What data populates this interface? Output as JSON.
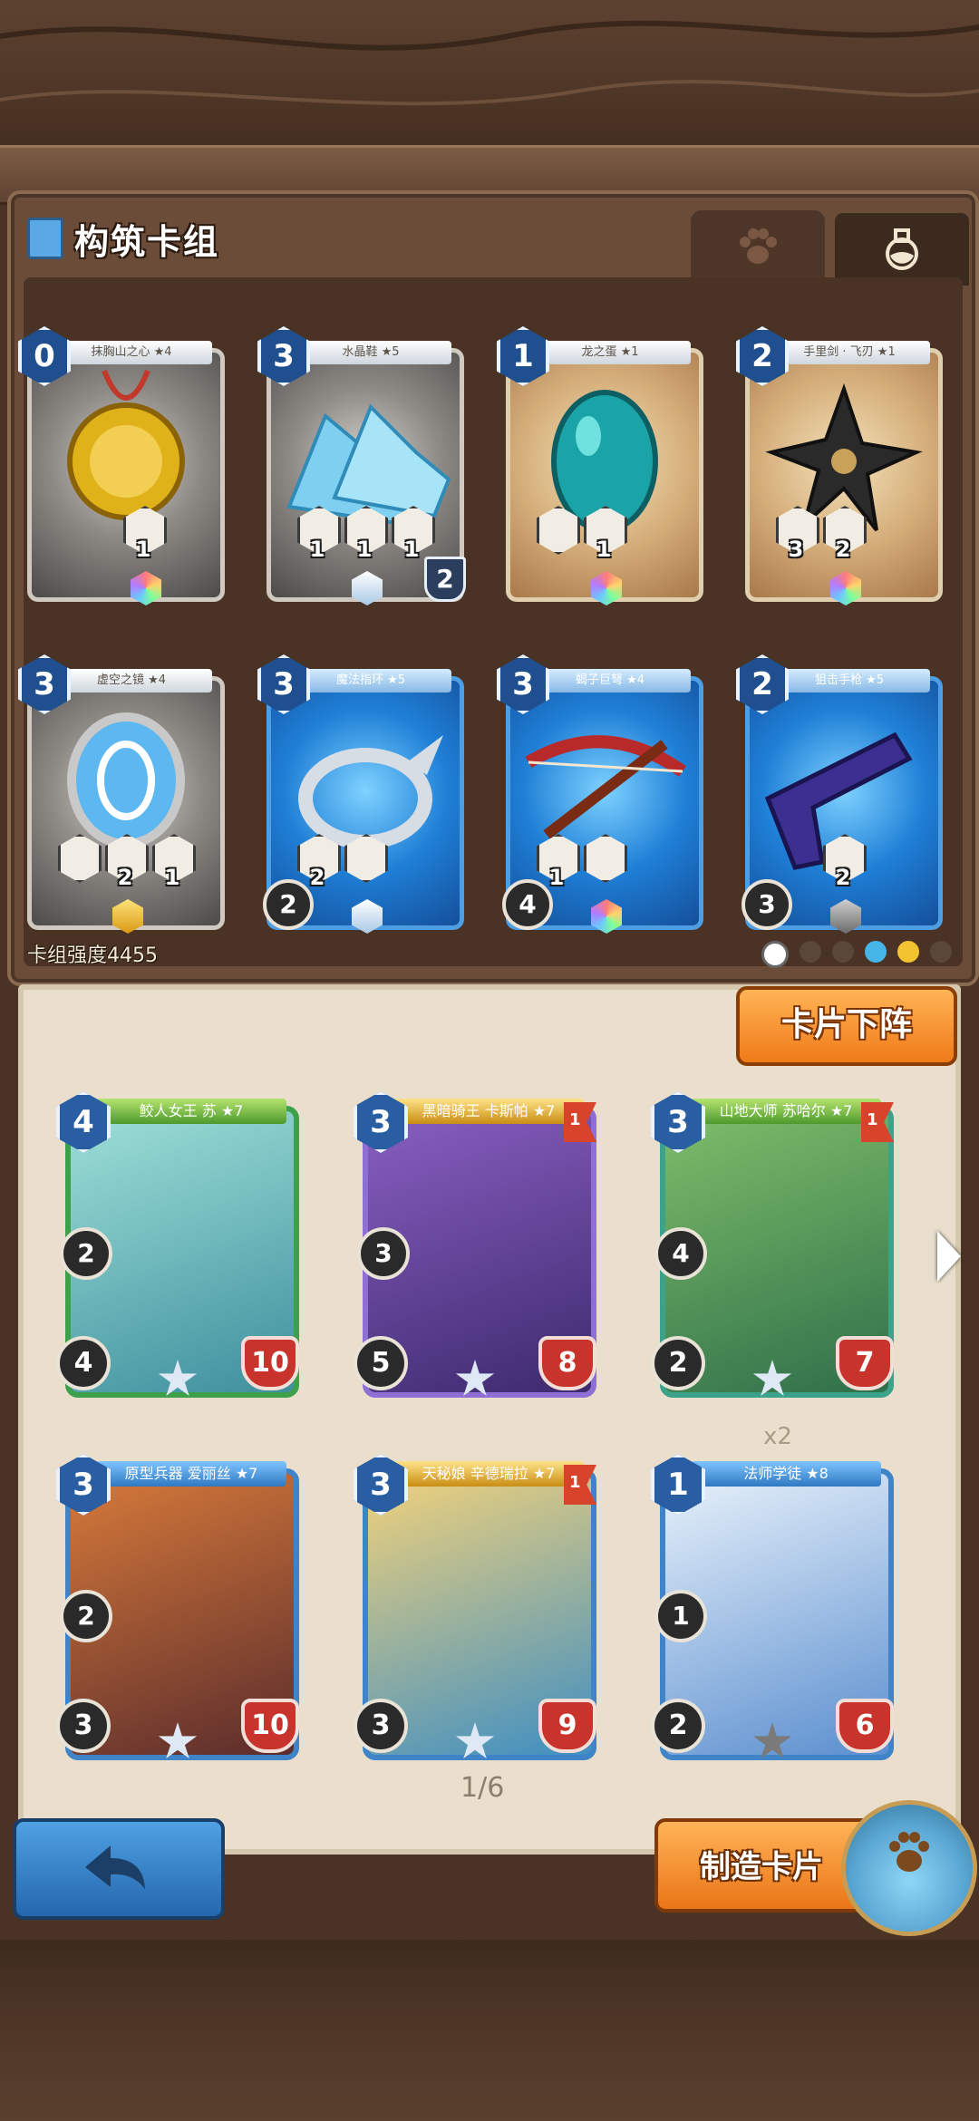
{
  "deck": {
    "title": "构筑卡组",
    "strength_label": "卡组强度4455",
    "tabs": [
      {
        "icon": "paw-icon"
      },
      {
        "icon": "potion-icon"
      }
    ],
    "cards": [
      {
        "name": "抹胸山之心 ★4",
        "cost": "0",
        "style": "gray",
        "stats": [
          "1"
        ],
        "gem": "rainbow"
      },
      {
        "name": "水晶鞋 ★5",
        "cost": "3",
        "style": "gray",
        "stats": [
          "1",
          "1",
          "1"
        ],
        "gem": "white",
        "badge": "2"
      },
      {
        "name": "龙之蛋 ★1",
        "cost": "1",
        "style": "tan",
        "stats": [
          "1"
        ],
        "gem": "rainbow"
      },
      {
        "name": "手里剑 · 飞刃 ★1",
        "cost": "2",
        "style": "tan",
        "stats": [
          "3",
          "2"
        ],
        "gem": "rainbow"
      },
      {
        "name": "虚空之镜 ★4",
        "cost": "3",
        "style": "gray",
        "stats": [
          "2",
          "1"
        ],
        "gem": "gold"
      },
      {
        "name": "魔法指环 ★5",
        "cost": "3",
        "style": "blue",
        "stats": [
          "2"
        ],
        "gem": "white",
        "circle": "2"
      },
      {
        "name": "蝎子巨弩 ★4",
        "cost": "3",
        "style": "blue",
        "stats": [
          "1"
        ],
        "gem": "rainbow",
        "circle": "4"
      },
      {
        "name": "狙击手枪 ★5",
        "cost": "2",
        "style": "blue",
        "stats": [
          "2"
        ],
        "gem": "gray",
        "circle": "3"
      }
    ]
  },
  "collection": {
    "remove_button": "卡片下阵",
    "cards": [
      {
        "name": "鲛人女王 苏 ★7",
        "cost": "4",
        "mid": "2",
        "atk": "4",
        "hp": "10",
        "frame": "green",
        "label": "green"
      },
      {
        "name": "黑暗骑王 卡斯帕 ★7",
        "cost": "3",
        "mid": "3",
        "atk": "5",
        "hp": "8",
        "frame": "purple",
        "label": "gold",
        "flag": "1"
      },
      {
        "name": "山地大师 苏哈尔 ★7",
        "cost": "3",
        "mid": "4",
        "atk": "2",
        "hp": "7",
        "frame": "teal",
        "label": "green",
        "flag": "1"
      },
      {
        "name": "原型兵器 爱丽丝 ★7",
        "cost": "3",
        "mid": "2",
        "atk": "3",
        "hp": "10",
        "frame": "blue",
        "label": "blue"
      },
      {
        "name": "天秘娘 辛德瑞拉 ★7",
        "cost": "3",
        "mid": "",
        "atk": "3",
        "hp": "9",
        "frame": "blue",
        "label": "gold",
        "flag": "1"
      },
      {
        "name": "法师学徒 ★8",
        "cost": "1",
        "mid": "1",
        "atk": "2",
        "hp": "6",
        "frame": "blue",
        "label": "blue"
      }
    ],
    "duplicate": "x2",
    "page": "1/6"
  },
  "bottom": {
    "back_icon": "back-arrow-icon",
    "craft_button": "制造卡片"
  }
}
